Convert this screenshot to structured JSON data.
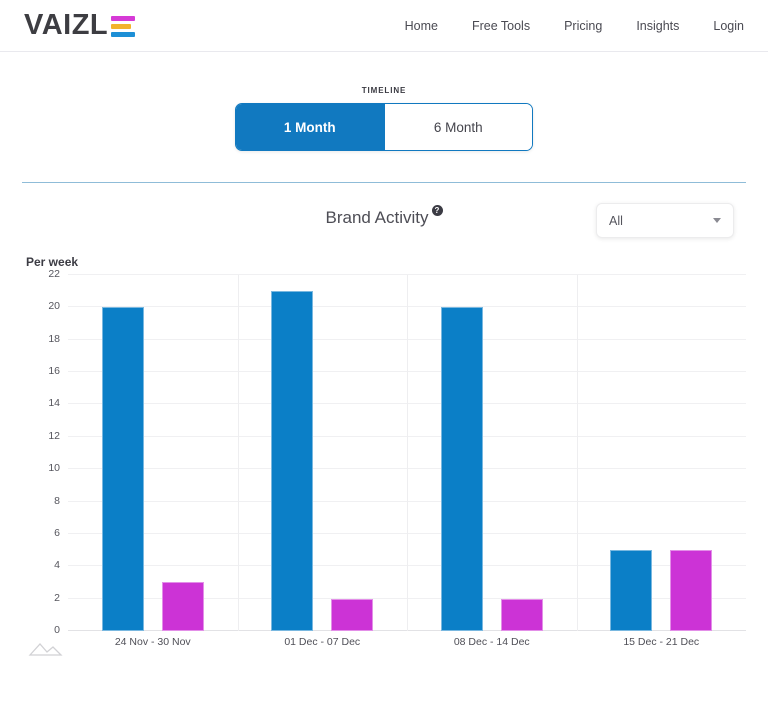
{
  "header": {
    "logo_text": "VAIZL",
    "logo_icon": "stacked-bars-e-icon",
    "logo_colors": [
      "#d63ad6",
      "#f2b32c",
      "#1d8fd6"
    ],
    "nav": [
      {
        "label": "Home"
      },
      {
        "label": "Free Tools"
      },
      {
        "label": "Pricing"
      },
      {
        "label": "Insights"
      },
      {
        "label": "Login"
      }
    ]
  },
  "timeline": {
    "label": "TIMELINE",
    "options": [
      {
        "label": "1 Month",
        "active": true
      },
      {
        "label": "6 Month",
        "active": false
      }
    ],
    "active_color": "#1179c0"
  },
  "chart_header": {
    "title": "Brand Activity",
    "help_icon_glyph": "?",
    "filter_value": "All",
    "filter_icon": "chevron-down-icon"
  },
  "chart_data": {
    "type": "bar",
    "title": "Brand Activity",
    "ylabel": "Per week",
    "xlabel": "",
    "ylim": [
      0,
      22
    ],
    "yticks": [
      0,
      2,
      4,
      6,
      8,
      10,
      12,
      14,
      16,
      18,
      20,
      22
    ],
    "grid": true,
    "legend_position": "none",
    "categories": [
      "24 Nov - 30 Nov",
      "01 Dec - 07 Dec",
      "08 Dec - 14 Dec",
      "15 Dec - 21 Dec"
    ],
    "series": [
      {
        "name": "Series 1",
        "color": "#0b7fc7",
        "values": [
          20,
          21,
          20,
          5
        ]
      },
      {
        "name": "Series 2",
        "color": "#cc33d6",
        "values": [
          3,
          2,
          2,
          5
        ]
      }
    ]
  },
  "footer": {
    "corner_icon": "mountain-chart-icon"
  }
}
